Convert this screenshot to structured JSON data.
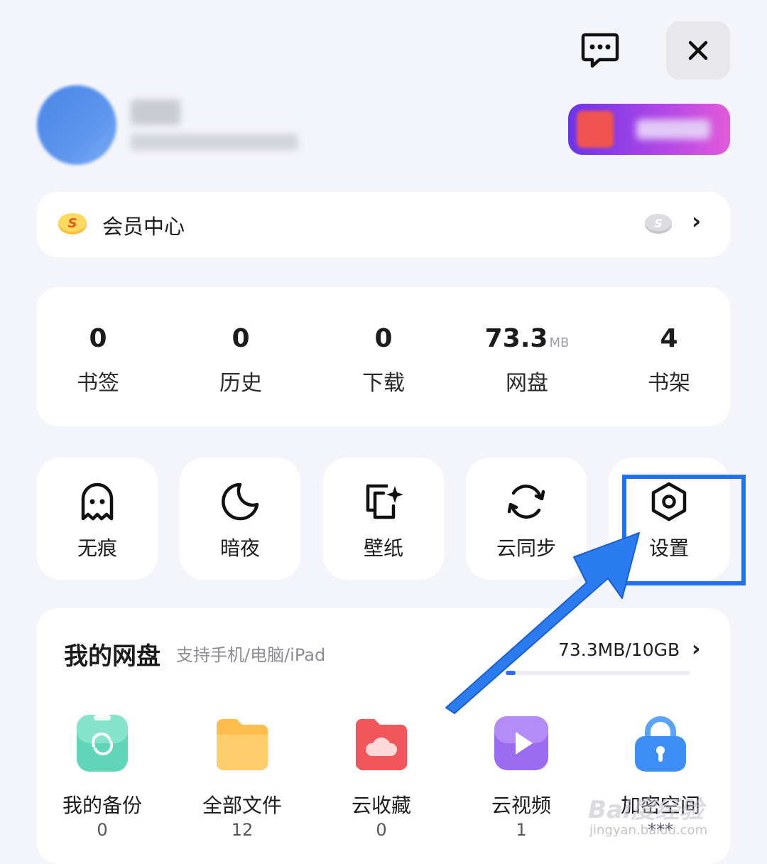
{
  "header": {
    "message_icon": "chat-dots-icon",
    "close_icon": "close-icon"
  },
  "member": {
    "label": "会员中心"
  },
  "stats": [
    {
      "value": "0",
      "unit": "",
      "label": "书签"
    },
    {
      "value": "0",
      "unit": "",
      "label": "历史"
    },
    {
      "value": "0",
      "unit": "",
      "label": "下载"
    },
    {
      "value": "73.3",
      "unit": "MB",
      "label": "网盘"
    },
    {
      "value": "4",
      "unit": "",
      "label": "书架"
    }
  ],
  "tools": [
    {
      "label": "无痕",
      "icon": "ghost-icon"
    },
    {
      "label": "暗夜",
      "icon": "moon-icon"
    },
    {
      "label": "壁纸",
      "icon": "wallpaper-icon"
    },
    {
      "label": "云同步",
      "icon": "sync-icon"
    },
    {
      "label": "设置",
      "icon": "settings-hexagon-icon"
    }
  ],
  "disk": {
    "title": "我的网盘",
    "subtitle": "支持手机/电脑/iPad",
    "usage": "73.3MB/10GB",
    "usage_fraction": 0.007,
    "apps": [
      {
        "label": "我的备份",
        "count": "0",
        "icon": "backup-phone-icon",
        "color": "#5fd6b8"
      },
      {
        "label": "全部文件",
        "count": "12",
        "icon": "folder-icon",
        "color": "#ffbe4d"
      },
      {
        "label": "云收藏",
        "count": "0",
        "icon": "cloud-folder-icon",
        "color": "#f0565a"
      },
      {
        "label": "云视频",
        "count": "1",
        "icon": "video-play-icon",
        "color": "#9b6cf2"
      },
      {
        "label": "加密空间",
        "count": "***",
        "icon": "lock-icon",
        "color": "#3d8ff5"
      }
    ]
  },
  "watermark": {
    "text": "Bai度经验",
    "sub": "jingyan.baidu.com"
  },
  "colors": {
    "highlight": "#1f72f0",
    "background": "#f4f5fb"
  }
}
